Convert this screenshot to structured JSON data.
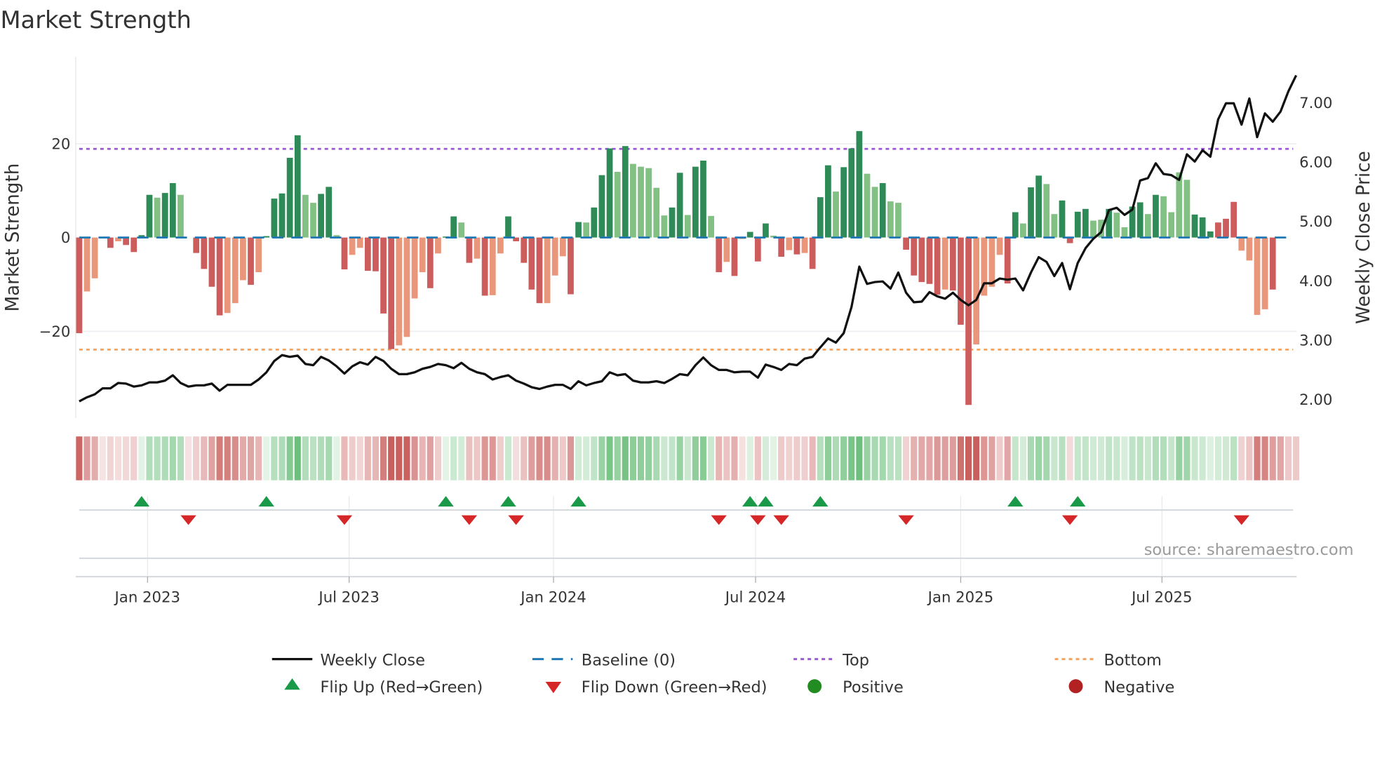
{
  "chart_data": {
    "type": "bar",
    "title": "Market Strength",
    "ylabel": "Market Strength",
    "y2label": "Weekly Close Price",
    "ylim": [
      -38.5,
      38.5
    ],
    "y2lim": [
      1.69,
      7.77
    ],
    "y_ticks": [
      {
        "value": 20,
        "label": "20"
      },
      {
        "value": 0,
        "label": "0"
      },
      {
        "value": -20,
        "label": "−20"
      }
    ],
    "y2_ticks": [
      {
        "value": 7,
        "label": "7.00"
      },
      {
        "value": 6,
        "label": "6.00"
      },
      {
        "value": 5,
        "label": "5.00"
      },
      {
        "value": 4,
        "label": "4.00"
      },
      {
        "value": 3,
        "label": "3.00"
      },
      {
        "value": 2,
        "label": "2.00"
      }
    ],
    "x_ticks": [
      {
        "label": "Jan 2023",
        "week": 8.76
      },
      {
        "label": "Jul 2023",
        "week": 34.6
      },
      {
        "label": "Jan 2024",
        "week": 60.8
      },
      {
        "label": "Jul 2024",
        "week": 86.7
      },
      {
        "label": "Jan 2025",
        "week": 113.0
      },
      {
        "label": "Jul 2025",
        "week": 138.8
      }
    ],
    "top_level": 18.9,
    "bottom_level": -23.9,
    "baseline": 0,
    "strength": [
      -20.4,
      -11.5,
      -8.7,
      0,
      -2.2,
      -0.8,
      -1.6,
      -3.1,
      0.5,
      9.1,
      8.5,
      9.5,
      11.6,
      9.1,
      0,
      -3.3,
      -6.7,
      -10.5,
      -16.6,
      -16.1,
      -14,
      -9.1,
      -10.1,
      -7.4,
      0.3,
      8.3,
      9.4,
      17,
      21.8,
      9.1,
      7.4,
      9.3,
      10.8,
      0.5,
      -6.8,
      -3.7,
      -2.2,
      -7.1,
      -7.2,
      -16.2,
      -23.8,
      -23,
      -21.2,
      -13,
      -7.4,
      -10.8,
      -3.4,
      0.2,
      4.5,
      3.2,
      -5.4,
      -4.5,
      -12.4,
      -12.3,
      -3.4,
      4.5,
      -0.8,
      -5.4,
      -11.1,
      -14,
      -14,
      -8.1,
      -4,
      -12.1,
      3.3,
      3.2,
      6.4,
      13.3,
      19,
      14,
      19.5,
      15.7,
      15.1,
      14.8,
      10.6,
      4.7,
      6.4,
      13.8,
      4.8,
      15.1,
      16.4,
      4.6,
      -7.4,
      -5.2,
      -8.2,
      -0.3,
      1.2,
      -5.1,
      3,
      0.4,
      -4.1,
      -2.7,
      -3.6,
      -3.3,
      -6.7,
      8.6,
      15.4,
      9.8,
      15,
      19,
      22.7,
      13.6,
      10.8,
      11.6,
      7.7,
      7.4,
      -2.6,
      -8.1,
      -9.5,
      -9.9,
      -12.2,
      -11.1,
      -11.3,
      -18.6,
      -35.7,
      -22.8,
      -12.4,
      -10.5,
      -3.7,
      -9.8,
      5.4,
      3,
      10.7,
      13.2,
      11.4,
      5,
      7.9,
      -1.2,
      5.5,
      6.1,
      3.6,
      3.8,
      6.1,
      5.3,
      2.2,
      6.6,
      7.5,
      5,
      9.1,
      8.8,
      5.4,
      13.9,
      12.3,
      4.9,
      4.3,
      1.3,
      3.2,
      4,
      7.6,
      -2.8,
      -4.9,
      -16.5,
      -15.3,
      -11.1,
      -10,
      -4.1,
      -4.2
    ],
    "shade": "RrrxRrRRGGgGGgxRRRRrrrRrGGGGGggGGgRrrRRRRrrrrRrGGgRrRrrGRRRRrrrRGgGGGgGgggggGGgGGgRrRrGRGgRrRrRGGgGGGggGggRRRRRrRRRrrrrRGgGGggGRGGggGggGGgGggggGGGRRRrrrrR",
    "weekly_close": [
      1.97,
      2.04,
      2.09,
      2.19,
      2.19,
      2.28,
      2.27,
      2.22,
      2.24,
      2.29,
      2.29,
      2.32,
      2.41,
      2.28,
      2.22,
      2.24,
      2.24,
      2.27,
      2.15,
      2.25,
      2.25,
      2.25,
      2.25,
      2.34,
      2.46,
      2.65,
      2.75,
      2.72,
      2.74,
      2.6,
      2.58,
      2.72,
      2.66,
      2.56,
      2.44,
      2.56,
      2.63,
      2.59,
      2.72,
      2.65,
      2.52,
      2.43,
      2.43,
      2.46,
      2.52,
      2.55,
      2.6,
      2.58,
      2.53,
      2.62,
      2.52,
      2.46,
      2.43,
      2.34,
      2.38,
      2.41,
      2.32,
      2.27,
      2.21,
      2.18,
      2.22,
      2.25,
      2.25,
      2.18,
      2.31,
      2.24,
      2.28,
      2.31,
      2.46,
      2.41,
      2.43,
      2.32,
      2.29,
      2.29,
      2.31,
      2.28,
      2.35,
      2.43,
      2.41,
      2.58,
      2.71,
      2.58,
      2.5,
      2.5,
      2.46,
      2.47,
      2.47,
      2.37,
      2.59,
      2.55,
      2.5,
      2.6,
      2.58,
      2.69,
      2.72,
      2.88,
      3.03,
      2.96,
      3.12,
      3.56,
      4.24,
      3.95,
      3.98,
      3.99,
      3.87,
      4.14,
      3.8,
      3.64,
      3.65,
      3.81,
      3.74,
      3.7,
      3.8,
      3.68,
      3.59,
      3.68,
      3.96,
      3.96,
      4.04,
      4.02,
      4.04,
      3.84,
      4.14,
      4.4,
      4.32,
      4.08,
      4.3,
      3.86,
      4.3,
      4.55,
      4.71,
      4.82,
      5.19,
      5.23,
      5.11,
      5.2,
      5.69,
      5.73,
      5.98,
      5.8,
      5.78,
      5.7,
      6.13,
      6.01,
      6.2,
      6.09,
      6.72,
      6.99,
      6.99,
      6.63,
      7.07,
      6.42,
      6.82,
      6.68,
      6.85,
      7.19,
      7.46
    ],
    "flip_up_weeks": [
      8,
      24,
      47,
      55,
      64,
      86,
      88,
      95,
      120,
      128
    ],
    "flip_down_weeks": [
      14,
      34,
      50,
      56,
      82,
      87,
      90,
      106,
      127,
      149
    ],
    "legend": [
      {
        "key": "weekly_close",
        "label": "Weekly Close"
      },
      {
        "key": "baseline",
        "label": "Baseline (0)"
      },
      {
        "key": "top",
        "label": "Top"
      },
      {
        "key": "bottom",
        "label": "Bottom"
      },
      {
        "key": "flip_up",
        "label": "Flip Up (Red→Green)"
      },
      {
        "key": "flip_down",
        "label": "Flip Down (Green→Red)"
      },
      {
        "key": "positive",
        "label": "Positive"
      },
      {
        "key": "negative",
        "label": "Negative"
      }
    ],
    "source": "source: sharemaestro.com"
  },
  "colors": {
    "strong_green": "#2e8b57",
    "weak_green": "#82c084",
    "strong_red": "#cd5c5c",
    "weak_red": "#e9967a",
    "baseline": "#1f77b4",
    "top": "#9b59d6",
    "bottom": "#f4a460",
    "close": "#111111",
    "flip_up": "#1a9a48",
    "flip_down": "#d62728",
    "positive": "#228b22",
    "negative": "#b22222"
  }
}
